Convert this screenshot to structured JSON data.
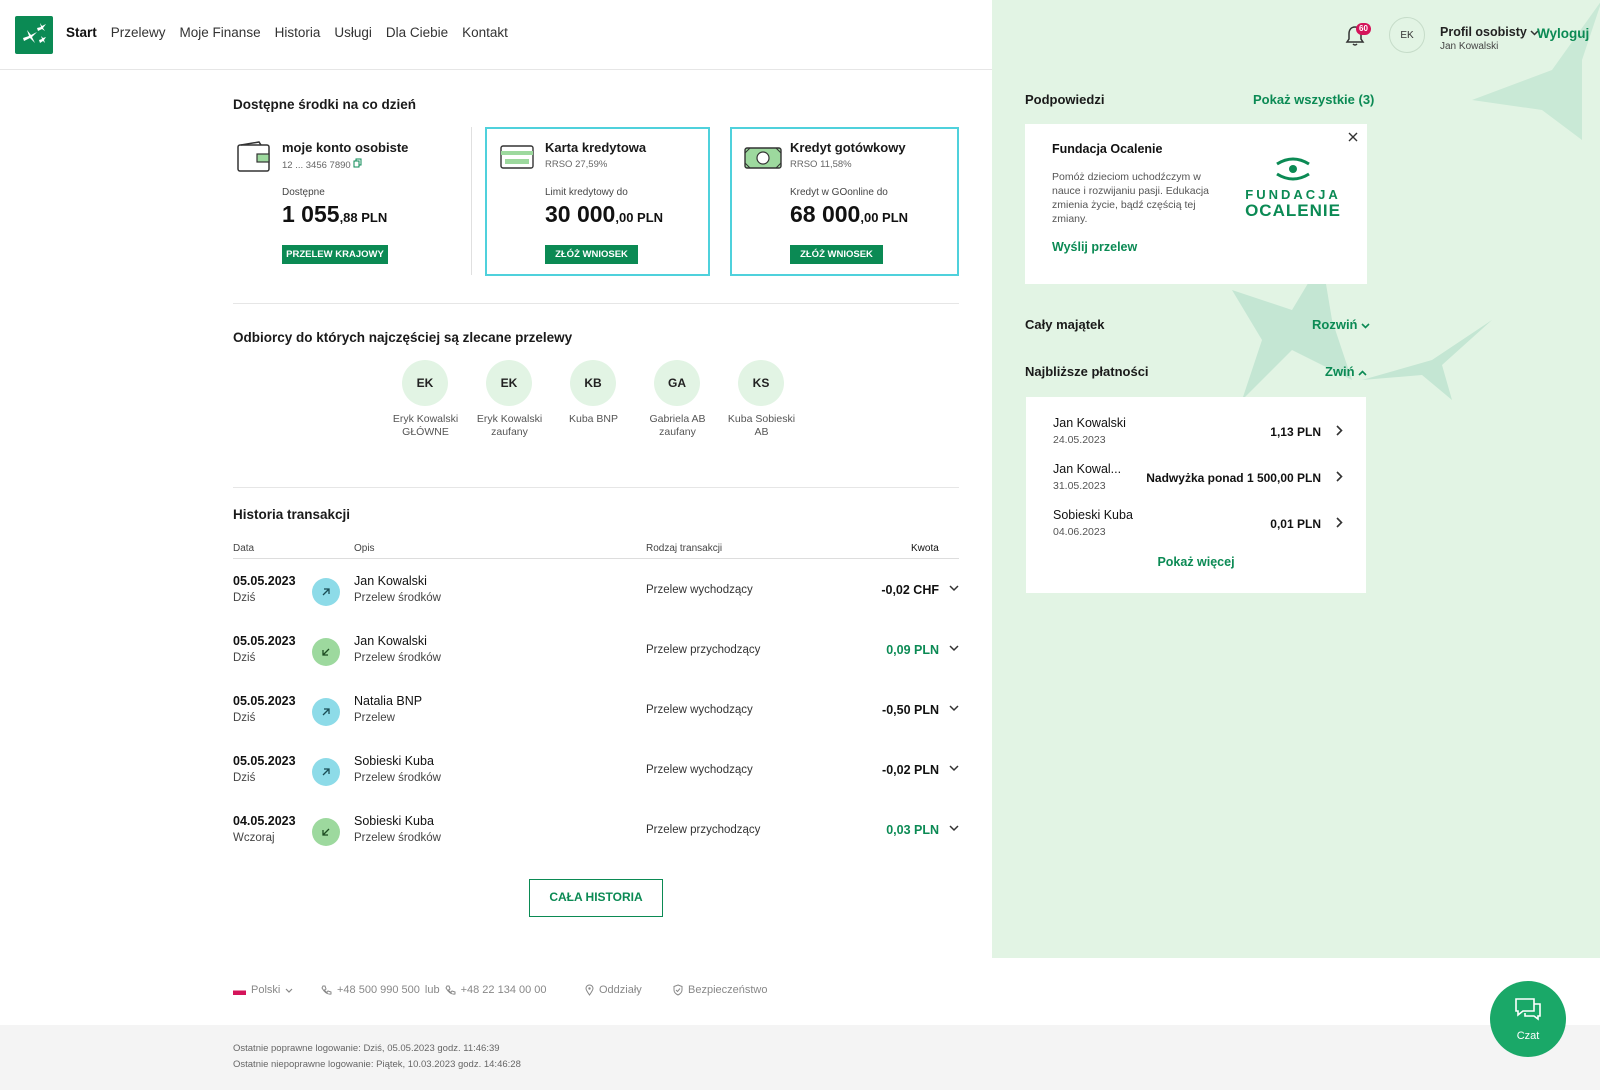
{
  "header": {
    "nav": [
      "Start",
      "Przelewy",
      "Moje Finanse",
      "Historia",
      "Usługi",
      "Dla Ciebie",
      "Kontakt"
    ],
    "notifications": "60",
    "avatar": "EK",
    "profile_label": "Profil osobisty",
    "profile_user": "Jan Kowalski",
    "logout": "Wyloguj"
  },
  "funds": {
    "title": "Dostępne środki na co dzień",
    "account": {
      "name": "moje konto osobiste",
      "number": "12 ... 3456 7890",
      "label": "Dostępne",
      "amount_int": "1 055",
      "amount_dec": ",88 PLN",
      "button": "PRZELEW KRAJOWY"
    },
    "credit_card": {
      "name": "Karta kredytowa",
      "rrso": "RRSO 27,59%",
      "label": "Limit kredytowy do",
      "amount_int": "30 000",
      "amount_dec": ",00 PLN",
      "button": "ZŁÓŻ WNIOSEK"
    },
    "cash_loan": {
      "name": "Kredyt gotówkowy",
      "rrso": "RRSO 11,58%",
      "label": "Kredyt w GOonline do",
      "amount_int": "68 000",
      "amount_dec": ",00 PLN",
      "button": "ZŁÓŻ WNIOSEK"
    }
  },
  "recipients": {
    "title": "Odbiorcy do których najczęściej są zlecane przelewy",
    "items": [
      {
        "initials": "EK",
        "name": "Eryk Kowalski GŁÓWNE"
      },
      {
        "initials": "EK",
        "name": "Eryk Kowalski zaufany"
      },
      {
        "initials": "KB",
        "name": "Kuba BNP"
      },
      {
        "initials": "GA",
        "name": "Gabriela AB zaufany"
      },
      {
        "initials": "KS",
        "name": "Kuba Sobieski AB"
      }
    ]
  },
  "history": {
    "title": "Historia transakcji",
    "columns": {
      "date": "Data",
      "desc": "Opis",
      "type": "Rodzaj transakcji",
      "amount": "Kwota"
    },
    "rows": [
      {
        "date": "05.05.2023",
        "day": "Dziś",
        "who": "Jan Kowalski",
        "desc": "Przelew środków",
        "type": "Przelew wychodzący",
        "amount": "-0,02 CHF",
        "dir": "out"
      },
      {
        "date": "05.05.2023",
        "day": "Dziś",
        "who": "Jan Kowalski",
        "desc": "Przelew środków",
        "type": "Przelew przychodzący",
        "amount": "0,09 PLN",
        "dir": "in"
      },
      {
        "date": "05.05.2023",
        "day": "Dziś",
        "who": "Natalia BNP",
        "desc": "Przelew",
        "type": "Przelew wychodzący",
        "amount": "-0,50 PLN",
        "dir": "out"
      },
      {
        "date": "05.05.2023",
        "day": "Dziś",
        "who": "Sobieski Kuba",
        "desc": "Przelew środków",
        "type": "Przelew wychodzący",
        "amount": "-0,02 PLN",
        "dir": "out"
      },
      {
        "date": "04.05.2023",
        "day": "Wczoraj",
        "who": "Sobieski Kuba",
        "desc": "Przelew środków",
        "type": "Przelew przychodzący",
        "amount": "0,03 PLN",
        "dir": "in"
      }
    ],
    "all_button": "CAŁA HISTORIA"
  },
  "hints": {
    "title": "Podpowiedzi",
    "show_all": "Pokaż wszystkie (3)",
    "card_title": "Fundacja Ocalenie",
    "card_text": "Pomóż dzieciom uchodźczym w nauce i rozwijaniu pasji. Edukacja zmienia życie, bądź częścią tej zmiany.",
    "card_link": "Wyślij przelew",
    "logo_line1": "FUNDACJA",
    "logo_line2": "OCALENIE"
  },
  "assets": {
    "title": "Cały majątek",
    "toggle": "Rozwiń"
  },
  "payments": {
    "title": "Najbliższe płatności",
    "toggle": "Zwiń",
    "items": [
      {
        "name": "Jan Kowalski",
        "date": "24.05.2023",
        "amount": "1,13 PLN"
      },
      {
        "name": "Jan Kowal...",
        "date": "31.05.2023",
        "amount": "Nadwyżka ponad 1 500,00 PLN"
      },
      {
        "name": "Sobieski Kuba",
        "date": "04.06.2023",
        "amount": "0,01 PLN"
      }
    ],
    "more": "Pokaż więcej"
  },
  "footer": {
    "language": "Polski",
    "phone1": "+48 500 990 500",
    "or": "lub",
    "phone2": "+48 22 134 00 00",
    "branches": "Oddziały",
    "security": "Bezpieczeństwo",
    "last_ok": "Ostatnie poprawne logowanie: Dziś, 05.05.2023 godz. 11:46:39",
    "last_fail": "Ostatnie niepoprawne logowanie: Piątek, 10.03.2023 godz. 14:46:28"
  },
  "chat": {
    "label": "Czat"
  },
  "colors": {
    "brand": "#0b8a54",
    "side_bg": "#e2f4e4",
    "outgoing": "#8ddbe8",
    "incoming": "#9dd99e",
    "badge": "#d4145a"
  }
}
